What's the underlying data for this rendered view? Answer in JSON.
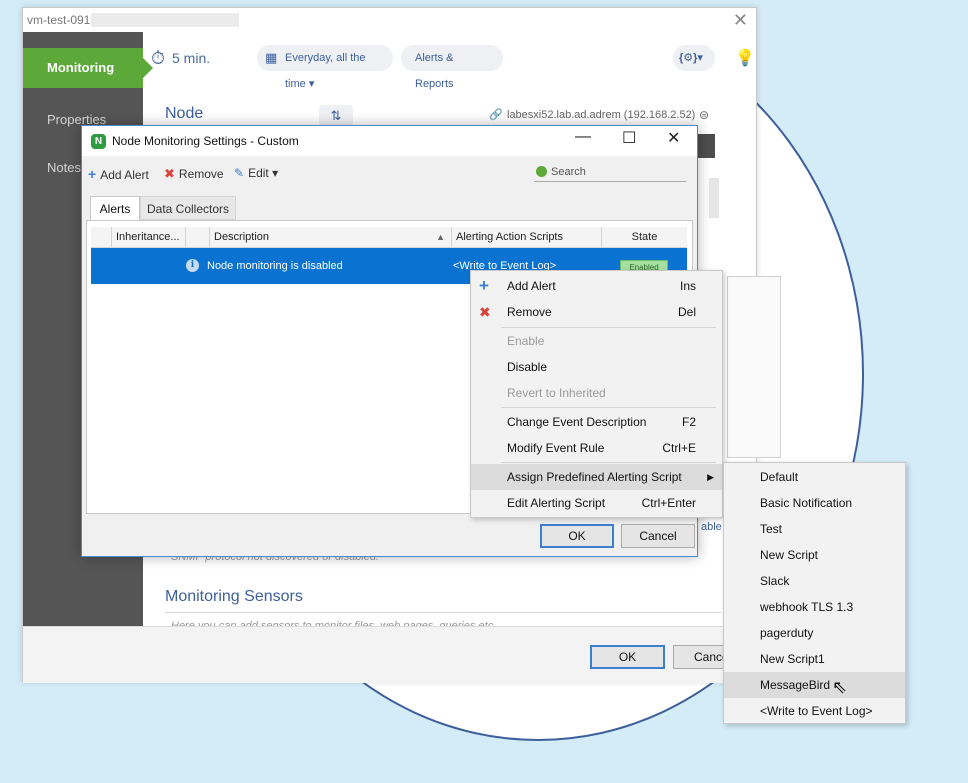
{
  "main_window": {
    "title": "vm-test-091",
    "close": "✕",
    "sidebar": [
      {
        "label": "Monitoring",
        "active": true
      },
      {
        "label": "Properties",
        "active": false
      },
      {
        "label": "Notes",
        "active": false
      }
    ],
    "topbar": {
      "interval": "5 min.",
      "schedule": "Everyday, all the time ▾",
      "alerts_reports": "Alerts & Reports",
      "script_menu": "{⚙}▾"
    },
    "node_label": "Node",
    "node_address": "labesxi52.lab.ad.adrem (192.168.2.52)",
    "snmp_note": "SNMP protocol not discovered or disabled.",
    "monitoring_sensors": "Monitoring Sensors",
    "sensors_note": "Here you can add sensors to monitor files, web pages, queries etc.",
    "right_edge_text": "able",
    "ok": "OK",
    "cancel": "Cance"
  },
  "dialog": {
    "title": "Node Monitoring Settings - Custom",
    "logo": "N",
    "toolbar": {
      "add_alert": "Add Alert",
      "remove": "Remove",
      "edit": "Edit ▾",
      "search_placeholder": "Search"
    },
    "tabs": [
      {
        "label": "Alerts",
        "active": true
      },
      {
        "label": "Data Collectors",
        "active": false
      }
    ],
    "columns": [
      "Inheritance...",
      "Description",
      "Alerting Action Scripts",
      "State"
    ],
    "row": {
      "description": "Node monitoring is disabled",
      "script": "<Write to Event Log>",
      "state": "Enabled"
    },
    "ok": "OK",
    "cancel": "Cancel"
  },
  "context_menu": [
    {
      "label": "Add Alert",
      "shortcut": "Ins",
      "icon": "plus-icon",
      "disabled": false
    },
    {
      "label": "Remove",
      "shortcut": "Del",
      "icon": "x-icon",
      "disabled": false
    },
    {
      "label": "Enable",
      "shortcut": "",
      "disabled": true
    },
    {
      "label": "Disable",
      "shortcut": "",
      "disabled": false
    },
    {
      "label": "Revert to Inherited",
      "shortcut": "",
      "disabled": true
    },
    {
      "label": "Change Event Description",
      "shortcut": "F2",
      "disabled": false
    },
    {
      "label": "Modify Event Rule",
      "shortcut": "Ctrl+E",
      "disabled": false
    },
    {
      "label": "Assign Predefined Alerting Script",
      "shortcut": "",
      "disabled": false,
      "highlighted": true
    },
    {
      "label": "Edit Alerting Script",
      "shortcut": "Ctrl+Enter",
      "disabled": false
    }
  ],
  "submenu": [
    "Default",
    "Basic Notification",
    "Test",
    "New Script",
    "Slack",
    "webhook TLS 1.3",
    "pagerduty",
    "New Script1",
    "MessageBird",
    "<Write to Event Log>"
  ],
  "colors": {
    "accent_green": "#5ca939",
    "selection_blue": "#0a73d1",
    "link_blue": "#3d5f9c"
  }
}
